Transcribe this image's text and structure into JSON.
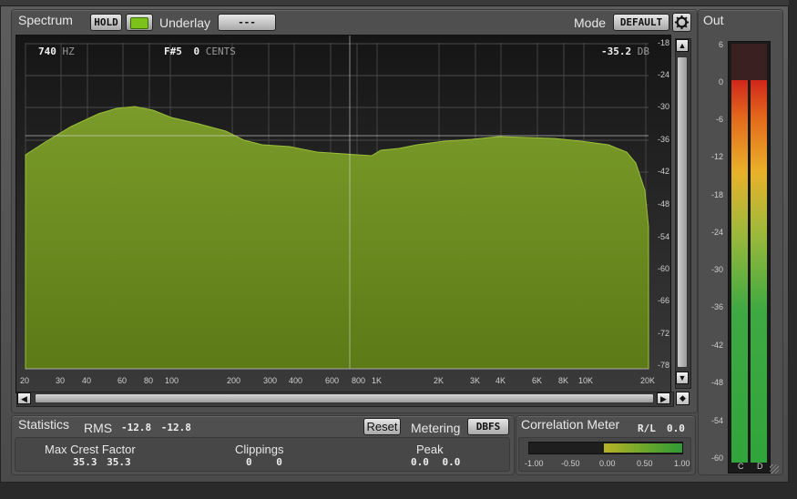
{
  "spectrum": {
    "title": "Spectrum",
    "hold_label": "HOLD",
    "underlay_label": "Underlay",
    "underlay_value": "---",
    "mode_label": "Mode",
    "mode_value": "DEFAULT",
    "readout": {
      "freq": "740",
      "freq_unit": "HZ",
      "note": "F#5",
      "cents": "0",
      "cents_unit": "CENTS",
      "level": "-35.2",
      "level_unit": "DB"
    },
    "db_ticks": [
      "-18",
      "-24",
      "-30",
      "-36",
      "-42",
      "-48",
      "-54",
      "-60",
      "-66",
      "-72",
      "-78"
    ],
    "freq_ticks": [
      "20",
      "30",
      "40",
      "60",
      "80",
      "100",
      "200",
      "300",
      "400",
      "600",
      "800",
      "1K",
      "2K",
      "3K",
      "4K",
      "6K",
      "8K",
      "10K",
      "20K"
    ]
  },
  "out": {
    "title": "Out",
    "scale": [
      "6",
      "0",
      "-6",
      "-12",
      "-18",
      "-24",
      "-30",
      "-36",
      "-42",
      "-48",
      "-54",
      "-60"
    ],
    "channels": [
      "C",
      "D"
    ]
  },
  "statistics": {
    "title": "Statistics",
    "rms_label": "RMS",
    "rms_values": [
      "-12.8",
      "-12.8"
    ],
    "reset_label": "Reset",
    "metering_label": "Metering",
    "metering_value": "DBFS",
    "max_crest_label": "Max Crest Factor",
    "max_crest_values": [
      "35.3",
      "35.3"
    ],
    "clippings_label": "Clippings",
    "clippings_values": [
      "0",
      "0"
    ],
    "peak_label": "Peak",
    "peak_values": [
      "0.0",
      "0.0"
    ]
  },
  "correlation": {
    "title": "Correlation Meter",
    "rl_label": "R/L",
    "rl_value": "0.0",
    "scale": [
      "-1.00",
      "-0.50",
      "0.00",
      "0.50",
      "1.00"
    ]
  },
  "colors": {
    "spectrum_fill": "#6b8a1f",
    "hold_led": "#7bc21b",
    "meter_red": "#d0261b",
    "meter_green": "#30a53b"
  },
  "icons": [
    "gear-icon",
    "arrow-left-icon",
    "arrow-right-icon",
    "arrow-up-icon",
    "arrow-down-icon",
    "diamond-icon",
    "resize-grip-icon"
  ]
}
